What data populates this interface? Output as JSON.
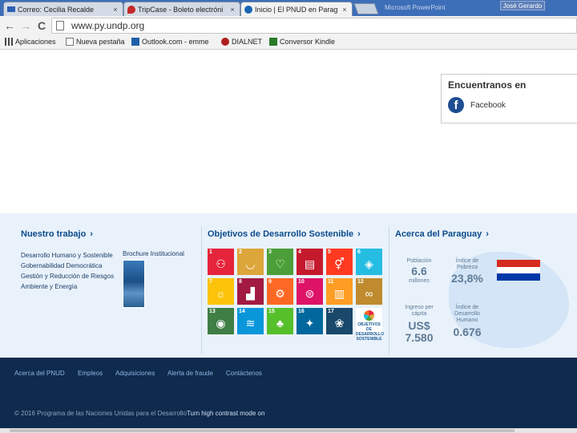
{
  "browser": {
    "tabs": [
      {
        "label": "Correo: Cecilia Recalde",
        "icon": "mail-icon",
        "close": "×"
      },
      {
        "label": "TripCase - Boleto electróni",
        "icon": "tripcase-icon",
        "close": "×"
      },
      {
        "label": "Inicio | El PNUD en Paraguay",
        "icon": "undp-favicon",
        "close": "×"
      }
    ],
    "inactive_window_title": "Microsoft PowerPoint",
    "user_name": "José Gerardo",
    "url": "www.py.undp.org",
    "nav": {
      "back": "←",
      "forward": "→",
      "reload": "C"
    },
    "bookmarks": [
      {
        "label": "Aplicaciones",
        "icon": "apps-icon"
      },
      {
        "label": "Nueva pestaña",
        "icon": "page-icon"
      },
      {
        "label": "Outlook.com - emme",
        "icon": "outlook-icon"
      },
      {
        "label": "DIALNET",
        "icon": "dialnet-icon"
      },
      {
        "label": "Conversor Kindle",
        "icon": "kindle-icon"
      }
    ]
  },
  "facebook": {
    "title": "Encuentranos en",
    "icon_glyph": "f",
    "link": "Facebook"
  },
  "nuestro_trabajo": {
    "title": "Nuestro trabajo",
    "chevron": "›",
    "links": [
      "Desarrollo Humano y Sostenible",
      "Gobernabilidad Democrática",
      "Gestión y Reducción de Riesgos",
      "Ambiente y Energía"
    ],
    "brochure": "Brochure Institucional"
  },
  "ods": {
    "title": "Objetivos de Desarrollo Sostenible",
    "chevron": "›",
    "goals": [
      {
        "n": "1",
        "color": "#e5243b",
        "glyph": "⚇"
      },
      {
        "n": "2",
        "color": "#dda63a",
        "glyph": "◡"
      },
      {
        "n": "3",
        "color": "#4c9f38",
        "glyph": "♡"
      },
      {
        "n": "4",
        "color": "#c5192d",
        "glyph": "▤"
      },
      {
        "n": "5",
        "color": "#ff3a21",
        "glyph": "⚥"
      },
      {
        "n": "6",
        "color": "#26bde2",
        "glyph": "◈"
      },
      {
        "n": "7",
        "color": "#fcc30b",
        "glyph": "☼"
      },
      {
        "n": "8",
        "color": "#a21942",
        "glyph": "▟"
      },
      {
        "n": "9",
        "color": "#fd6925",
        "glyph": "⚙"
      },
      {
        "n": "10",
        "color": "#dd1367",
        "glyph": "⊜"
      },
      {
        "n": "11",
        "color": "#fd9d24",
        "glyph": "▥"
      },
      {
        "n": "12",
        "color": "#bf8b2e",
        "glyph": "∞"
      },
      {
        "n": "13",
        "color": "#3f7e44",
        "glyph": "◉"
      },
      {
        "n": "14",
        "color": "#0a97d9",
        "glyph": "≋"
      },
      {
        "n": "15",
        "color": "#56c02b",
        "glyph": "♣"
      },
      {
        "n": "16",
        "color": "#00689d",
        "glyph": "✦"
      },
      {
        "n": "17",
        "color": "#19486a",
        "glyph": "❀"
      }
    ],
    "logo_text": "OBJETIVOS DE DESARROLLO SOSTENIBLE"
  },
  "paraguay": {
    "title": "Acerca del Paraguay",
    "chevron": "›",
    "poblacion_label": "Población",
    "poblacion_value": "6.6",
    "poblacion_unit": "millones",
    "pobreza_label": "Índice de Pobreza",
    "pobreza_value": "23,8%",
    "ingreso_label": "Ingreso per cápita",
    "ingreso_currency": "US$",
    "ingreso_value": "7.580",
    "idh_label": "Índice de Desarrollo Humano",
    "idh_value": "0.676",
    "flag_colors": [
      "#d52b1e",
      "#ffffff",
      "#0038a8"
    ]
  },
  "footer": {
    "links": [
      "Acerca del PNUD",
      "Empleos",
      "Adquisiciones",
      "Alerta de fraude",
      "Contáctenos"
    ],
    "copyright": "© 2016 Programa de las Naciones Unidas para el Desarrollo",
    "contrast": "Turn high contrast mode on"
  }
}
